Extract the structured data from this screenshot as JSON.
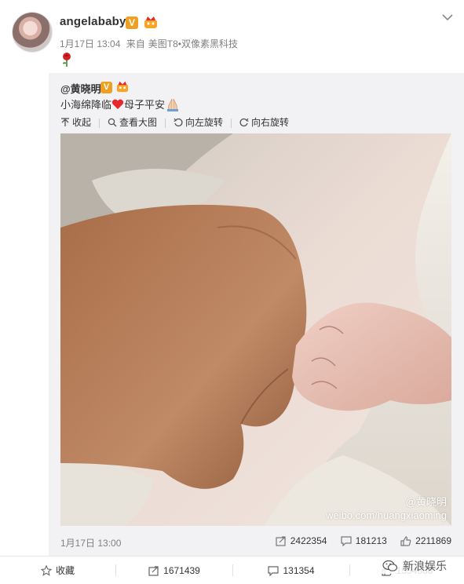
{
  "post": {
    "author": "angelababy",
    "verified_badge": "V",
    "timestamp": "1月17日 13:04",
    "source_prefix": "来自",
    "source": "美图T8•双像素黑科技",
    "emoji": "rose"
  },
  "repost": {
    "author": "@黄晓明",
    "verified_badge": "V",
    "text_part1": "小海绵降临",
    "text_part2": "母子平安",
    "actions": {
      "collapse": "收起",
      "view_large": "查看大图",
      "rotate_left": "向左旋转",
      "rotate_right": "向右旋转"
    },
    "watermark_handle": "@黄晓明",
    "watermark_url": "weibo.com/huangxiaoming",
    "timestamp": "1月17日 13:00",
    "stats": {
      "reposts": "2422354",
      "comments": "181213",
      "likes": "2211869"
    }
  },
  "footer": {
    "favorite": "收藏",
    "reposts": "1671439",
    "comments": "131354",
    "likes": "1554688"
  },
  "brand": {
    "label": "新浪娱乐"
  },
  "colors": {
    "accent_badge": "#f0a020",
    "heart": "#e8262d",
    "repost_bg": "#f2f2f5",
    "muted_text": "#808080"
  }
}
